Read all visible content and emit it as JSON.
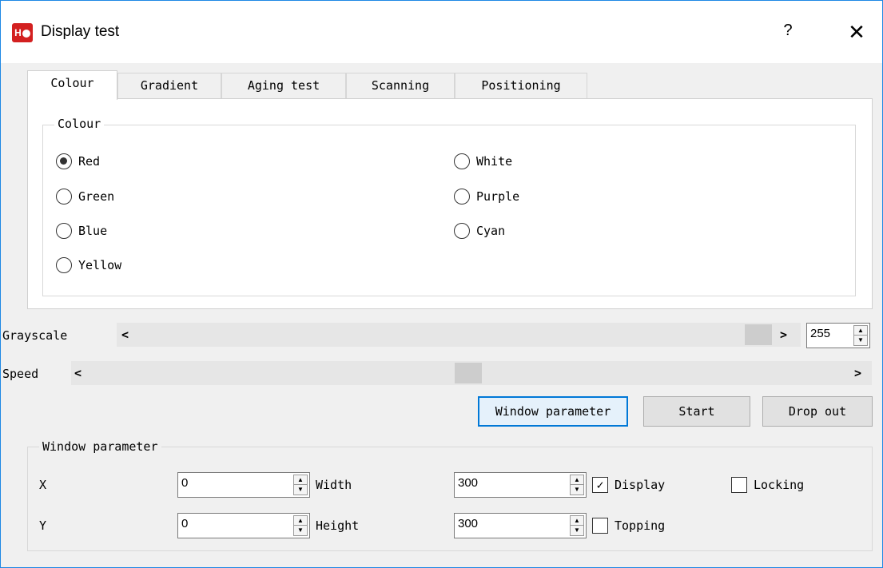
{
  "window": {
    "title": "Display test",
    "icon": "app-logo-icon",
    "help_label": "?",
    "close_label": "✕"
  },
  "tabs": [
    {
      "label": "Colour",
      "active": true
    },
    {
      "label": "Gradient",
      "active": false
    },
    {
      "label": "Aging test",
      "active": false
    },
    {
      "label": "Scanning",
      "active": false
    },
    {
      "label": "Positioning",
      "active": false
    }
  ],
  "colour_group": {
    "legend": "Colour",
    "options": [
      {
        "label": "Red",
        "checked": true
      },
      {
        "label": "Green",
        "checked": false
      },
      {
        "label": "Blue",
        "checked": false
      },
      {
        "label": "Yellow",
        "checked": false
      },
      {
        "label": "White",
        "checked": false
      },
      {
        "label": "Purple",
        "checked": false
      },
      {
        "label": "Cyan",
        "checked": false
      }
    ]
  },
  "grayscale": {
    "label": "Grayscale",
    "left_arrow": "<",
    "right_arrow": ">",
    "value": "255",
    "position": 1.0
  },
  "speed": {
    "label": "Speed",
    "left_arrow": "<",
    "right_arrow": ">",
    "position": 0.5
  },
  "buttons": {
    "window_parameter": "Window parameter",
    "start": "Start",
    "drop_out": "Drop out"
  },
  "window_parameter": {
    "legend": "Window parameter",
    "x_label": "X",
    "y_label": "Y",
    "x_value": "0",
    "y_value": "0",
    "width_label": "Width",
    "height_label": "Height",
    "width_value": "300",
    "height_value": "300",
    "display_label": "Display",
    "display_checked": true,
    "locking_label": "Locking",
    "locking_checked": false,
    "topping_label": "Topping",
    "topping_checked": false
  },
  "colors": {
    "focus_border": "#0078d7",
    "window_border": "#1e88e5",
    "logo_red": "#d32020"
  }
}
